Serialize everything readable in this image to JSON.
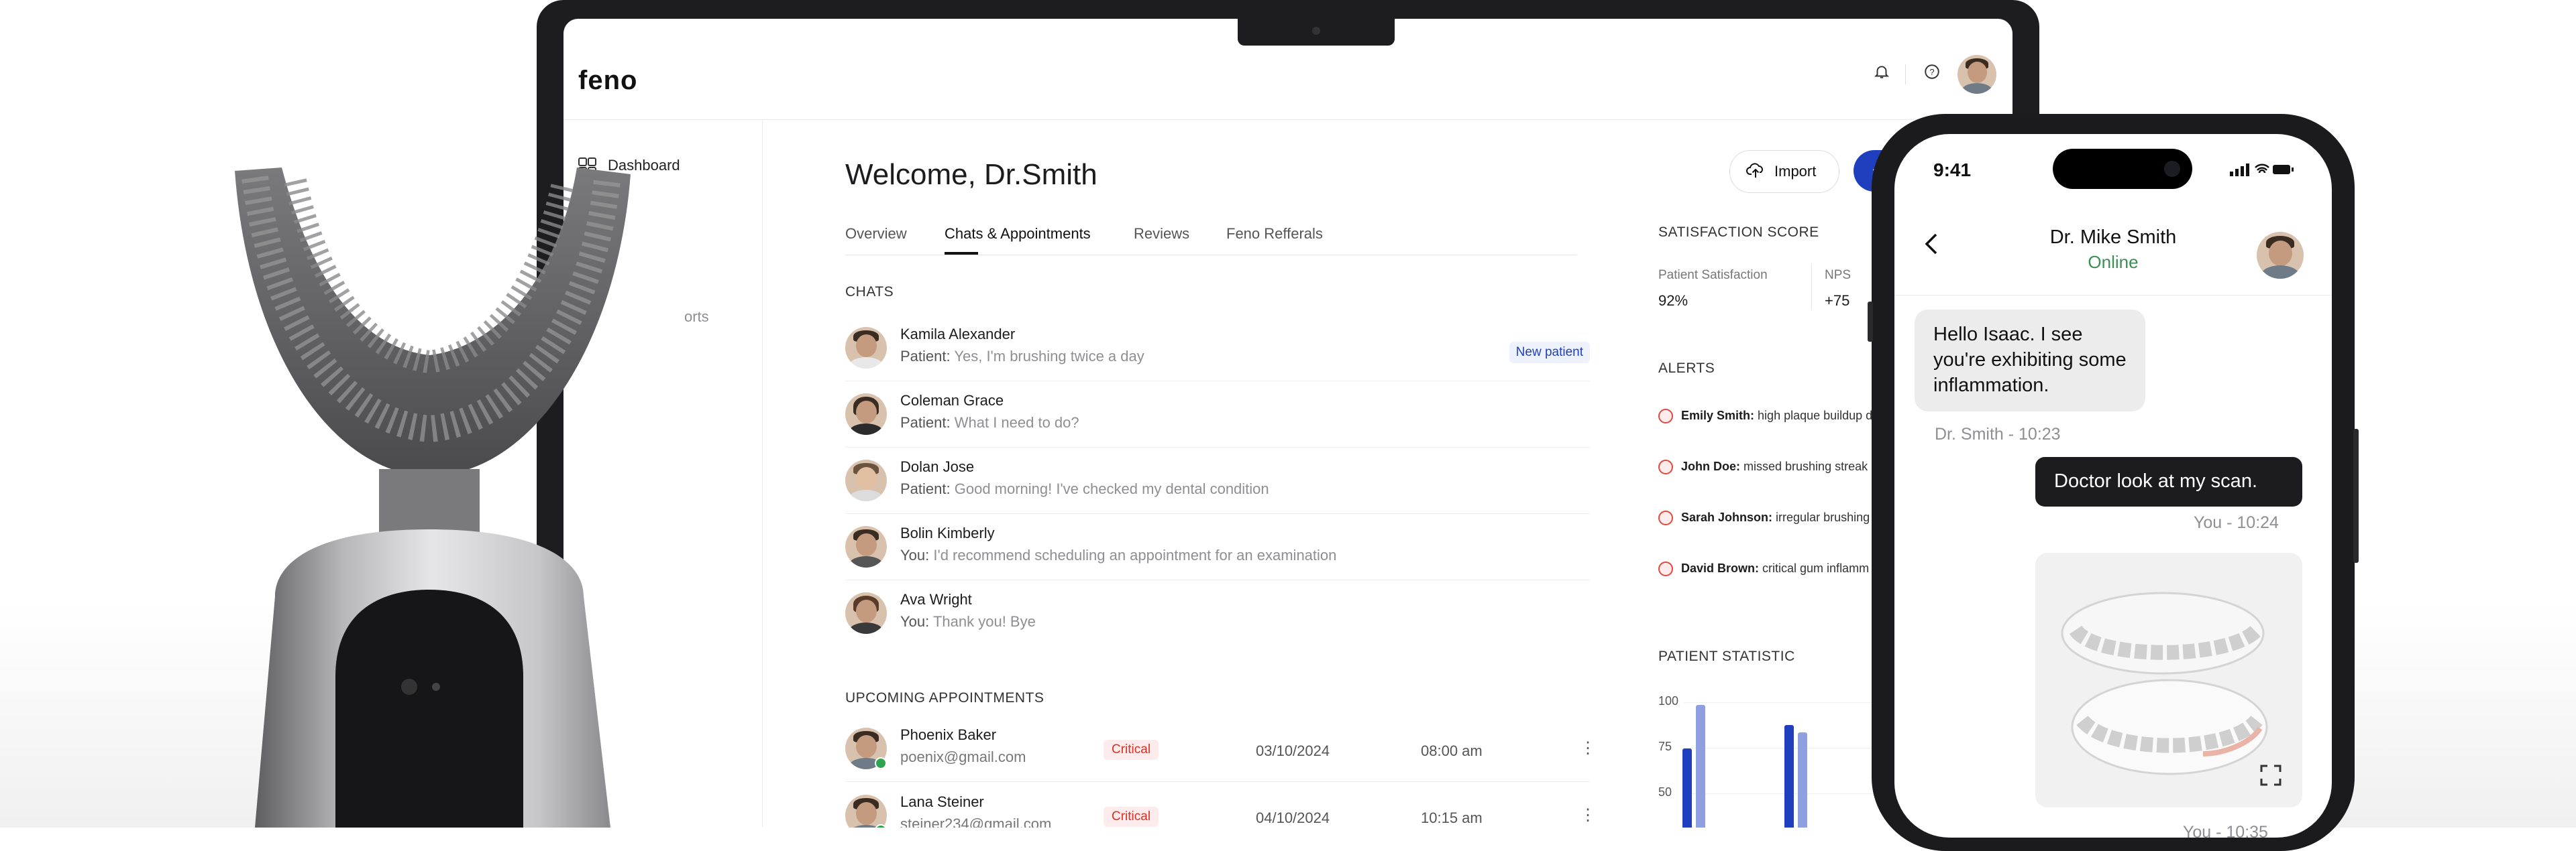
{
  "app": {
    "logo": "feno",
    "sidebar": {
      "dashboard": "Dashboard",
      "reports_partial": "orts"
    },
    "welcome": "Welcome, Dr.Smith",
    "tabs": [
      "Overview",
      "Chats & Appointments",
      "Reviews",
      "Feno Refferals"
    ],
    "active_tab": "Chats & Appointments",
    "buttons": {
      "import": "Import",
      "new_plus": "+"
    },
    "chats_heading": "CHATS",
    "chats": [
      {
        "name": "Kamila Alexander",
        "who": "Patient:",
        "text": "Yes, I'm brushing twice a day",
        "badge": "New patient"
      },
      {
        "name": "Coleman Grace",
        "who": "Patient:",
        "text": "What I need to do?"
      },
      {
        "name": "Dolan Jose",
        "who": "Patient:",
        "text": "Good morning! I've checked my dental condition"
      },
      {
        "name": "Bolin Kimberly",
        "who": "You:",
        "text": "I'd recommend scheduling an appointment for an examination"
      },
      {
        "name": "Ava Wright",
        "who": "You:",
        "text": "Thank you! Bye"
      }
    ],
    "appointments_heading": "UPCOMING APPOINTMENTS",
    "appointments": [
      {
        "name": "Phoenix Baker",
        "email": "poenix@gmail.com",
        "status": "Critical",
        "date": "03/10/2024",
        "time": "08:00 am"
      },
      {
        "name": "Lana Steiner",
        "email": "steiner234@gmail.com",
        "status": "Critical",
        "date": "04/10/2024",
        "time": "10:15 am"
      }
    ],
    "satisfaction": {
      "heading": "SATISFACTION SCORE",
      "patient_label": "Patient Satisfaction",
      "patient_value": "92%",
      "nps_label": "NPS",
      "nps_value": "+75"
    },
    "alerts_heading": "ALERTS",
    "alerts": [
      {
        "name": "Emily Smith:",
        "text": "high plaque buildup d"
      },
      {
        "name": "John Doe:",
        "text": "missed brushing streak"
      },
      {
        "name": "Sarah Johnson:",
        "text": "irregular brushing"
      },
      {
        "name": "David Brown:",
        "text": "critical gum inflamm"
      }
    ],
    "stat_heading": "PATIENT STATISTIC",
    "chart_data": {
      "type": "bar",
      "title": "PATIENT STATISTIC",
      "ylim": [
        0,
        100
      ],
      "yticks": [
        "100",
        "75",
        "50"
      ],
      "visible_bars": [
        {
          "group": 1,
          "values": [
            63,
            98
          ]
        },
        {
          "group": 2,
          "values": [
            82,
            76
          ]
        }
      ],
      "colors": [
        "#1f3fbf",
        "#8fa0e0"
      ]
    }
  },
  "phone": {
    "time": "9:41",
    "contact_name": "Dr. Mike Smith",
    "contact_status": "Online",
    "messages": {
      "in_text": "Hello Isaac. I see you're exhibiting some inflammation.",
      "in_meta": "Dr. Smith - 10:23",
      "out_text": "Doctor look at my scan.",
      "out_meta": "You - 10:24",
      "img_meta": "You - 10:35"
    }
  }
}
